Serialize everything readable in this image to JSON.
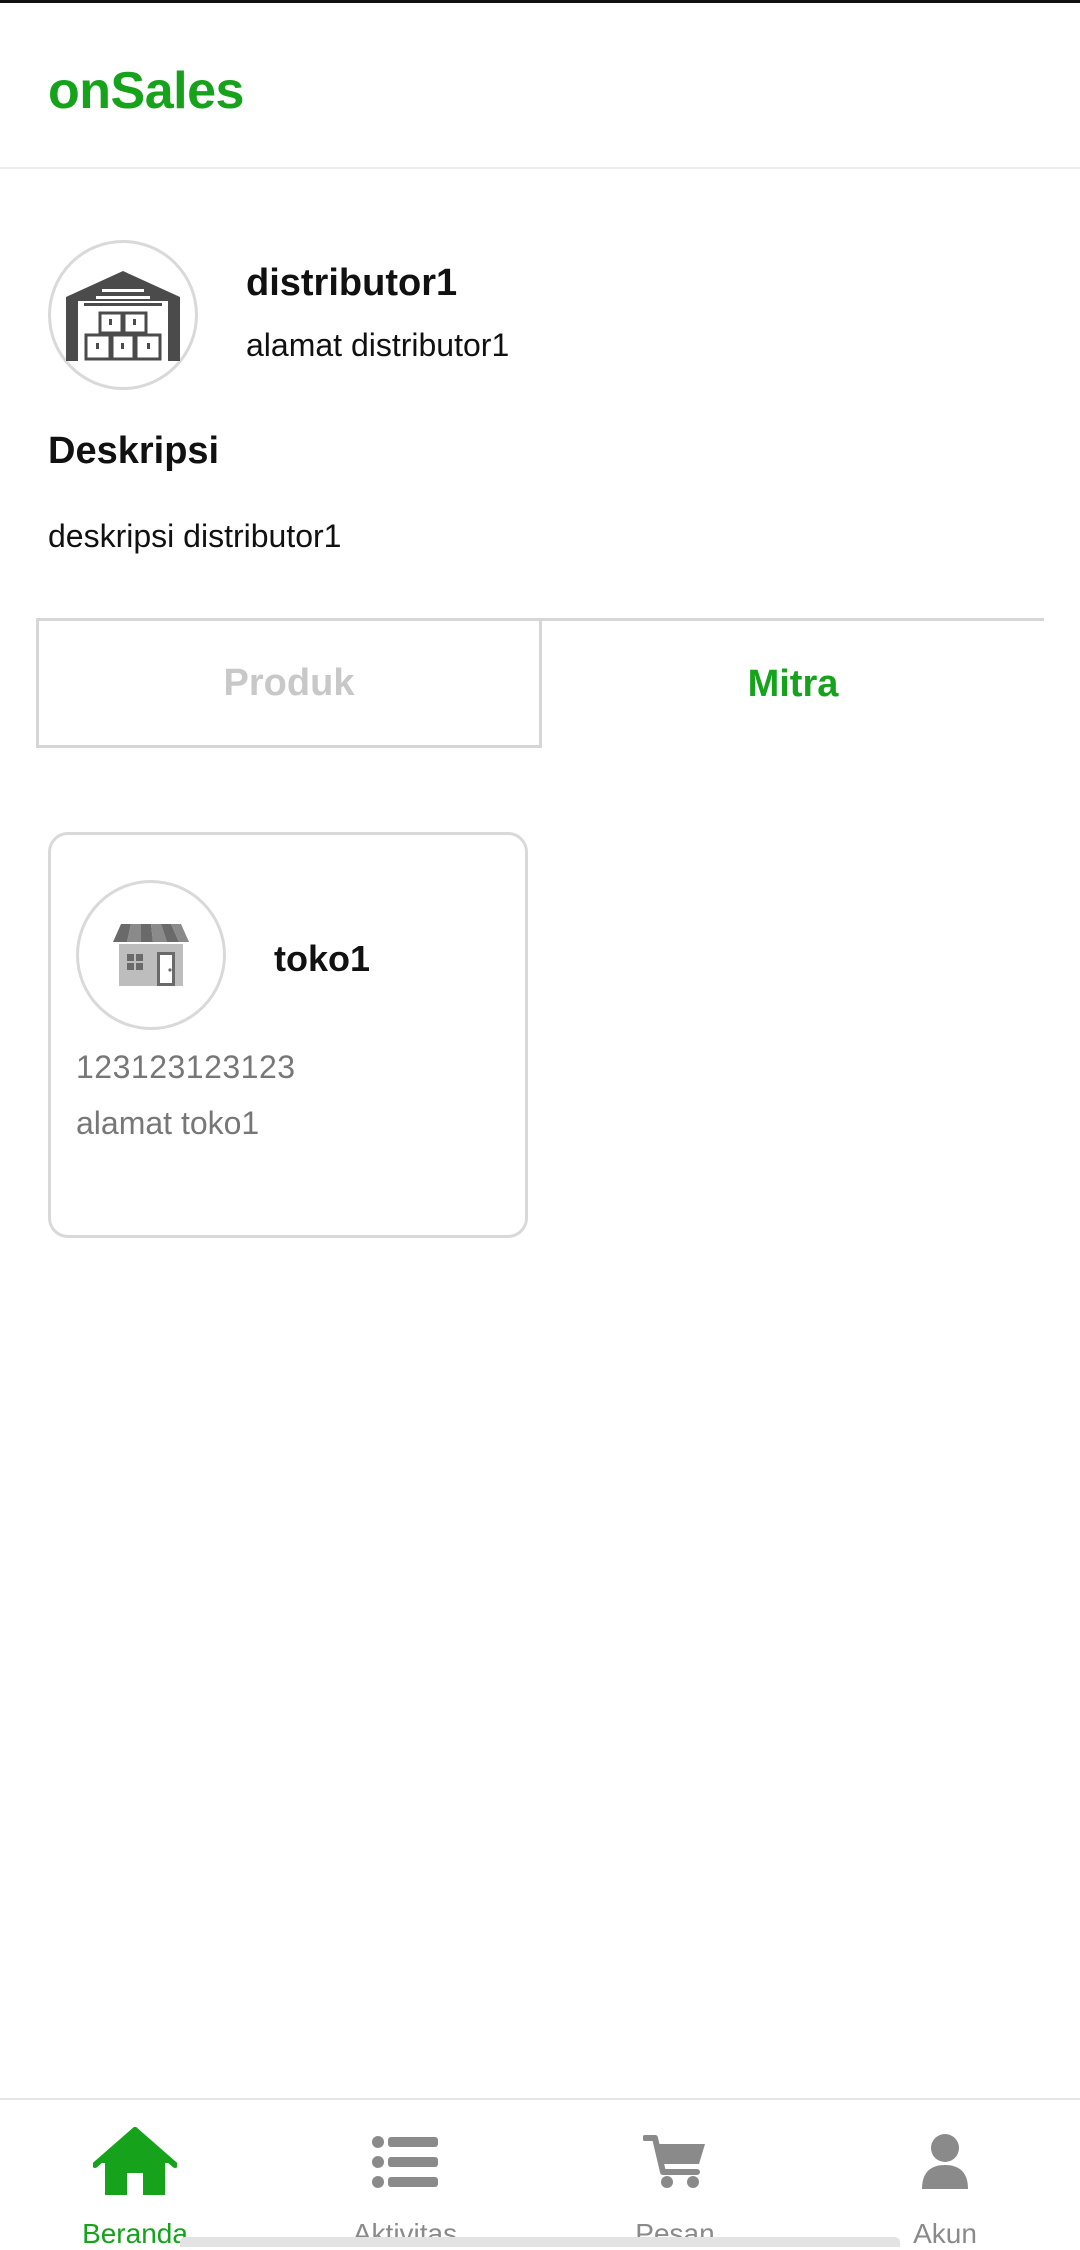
{
  "app": {
    "title": "onSales"
  },
  "profile": {
    "avatar_icon": "warehouse-icon",
    "name": "distributor1",
    "address": "alamat distributor1"
  },
  "description": {
    "heading": "Deskripsi",
    "text": "deskripsi distributor1"
  },
  "tabs": [
    {
      "label": "Produk",
      "active": false
    },
    {
      "label": "Mitra",
      "active": true
    }
  ],
  "partners": [
    {
      "icon": "store-icon",
      "name": "toko1",
      "phone": "123123123123",
      "address": "alamat toko1"
    }
  ],
  "bottom_nav": [
    {
      "label": "Beranda",
      "icon": "home-icon",
      "active": true
    },
    {
      "label": "Aktivitas",
      "icon": "list-icon",
      "active": false
    },
    {
      "label": "Pesan",
      "icon": "cart-icon",
      "active": false
    },
    {
      "label": "Akun",
      "icon": "user-icon",
      "active": false
    }
  ],
  "colors": {
    "brand": "#16a21b",
    "inactive": "#8a8a8a",
    "border": "#d9d9d9"
  }
}
